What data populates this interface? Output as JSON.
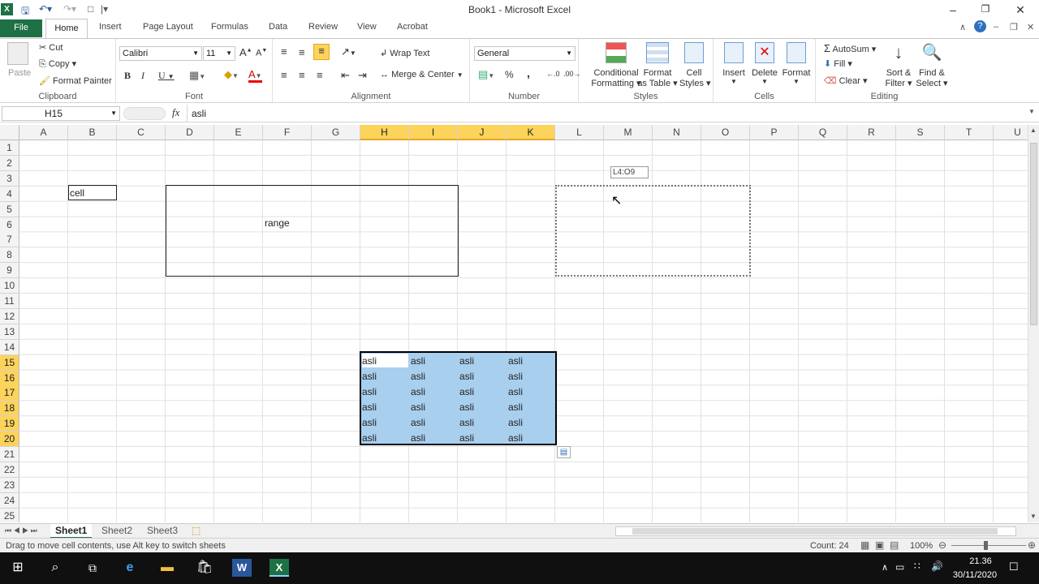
{
  "window": {
    "title": "Book1  -  Microsoft Excel",
    "app_icon": "X"
  },
  "tabs": [
    "Home",
    "Insert",
    "Page Layout",
    "Formulas",
    "Data",
    "Review",
    "View",
    "Acrobat"
  ],
  "file_tab": "File",
  "clipboard": {
    "paste": "Paste",
    "cut": "Cut",
    "copy": "Copy",
    "format_painter": "Format Painter",
    "label": "Clipboard"
  },
  "font": {
    "name": "Calibri",
    "size": "11",
    "bold": "B",
    "italic": "I",
    "underline": "U",
    "grow": "A",
    "shrink": "A",
    "color_letter": "A",
    "label": "Font"
  },
  "alignment": {
    "wrap": "Wrap Text",
    "merge": "Merge & Center",
    "label": "Alignment"
  },
  "number": {
    "format": "General",
    "percent": "%",
    "comma": ",",
    "label": "Number"
  },
  "styles": {
    "conditional": "Conditional",
    "conditional2": "Formatting",
    "table": "Format",
    "table2": "as Table",
    "cell": "Cell",
    "cell2": "Styles",
    "label": "Styles"
  },
  "cells": {
    "insert": "Insert",
    "delete": "Delete",
    "format": "Format",
    "label": "Cells"
  },
  "editing": {
    "autosum": "AutoSum",
    "fill": "Fill",
    "clear": "Clear",
    "sort": "Sort &",
    "sort2": "Filter",
    "find": "Find &",
    "find2": "Select",
    "label": "Editing"
  },
  "formula": {
    "namebox": "H15",
    "fx": "fx",
    "value": "asli"
  },
  "columns": [
    "A",
    "B",
    "C",
    "D",
    "E",
    "F",
    "G",
    "H",
    "I",
    "J",
    "K",
    "L",
    "M",
    "N",
    "O",
    "P",
    "Q",
    "R",
    "S",
    "T",
    "U"
  ],
  "rows": [
    "1",
    "2",
    "3",
    "4",
    "5",
    "6",
    "7",
    "8",
    "9",
    "10",
    "11",
    "12",
    "13",
    "14",
    "15",
    "16",
    "17",
    "18",
    "19",
    "20",
    "21",
    "22",
    "23",
    "24",
    "25"
  ],
  "cells_content": {
    "b4": "cell",
    "range": "range",
    "tooltip": "L4:O9",
    "fill": "asli"
  },
  "sheets": [
    "Sheet1",
    "Sheet2",
    "Sheet3"
  ],
  "status": {
    "message": "Drag to move cell contents, use Alt key to switch sheets",
    "count": "Count: 24",
    "zoom": "100%"
  },
  "taskbar": {
    "time": "21.36",
    "date": "30/11/2020"
  },
  "colors": {
    "excel_green": "#1e7145",
    "selection": "#a9cfef",
    "header_selected": "#fcd35b"
  }
}
